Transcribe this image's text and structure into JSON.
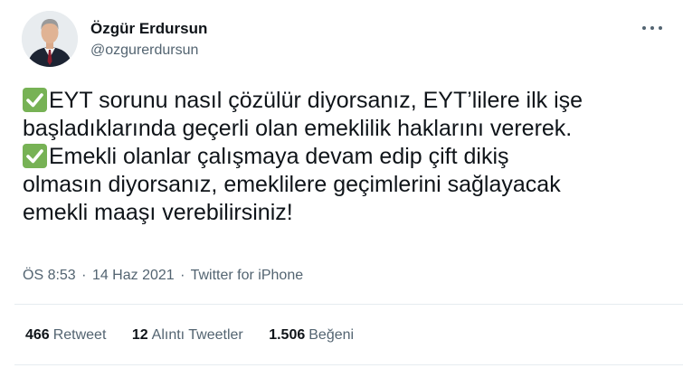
{
  "author": {
    "name": "Özgür Erdursun",
    "handle": "@ozgurerdursun"
  },
  "tweet": {
    "lines": [
      "EYT sorunu nasıl çözülür diyorsanız, EYT’lilere ilk işe",
      "başladıklarında geçerli olan emeklilik haklarını vererek.",
      "Emekli olanlar çalışmaya devam edip çift dikiş",
      "olmasın diyorsanız, emeklilere geçimlerini sağlayacak",
      "emekli maaşı verebilirsiniz!"
    ],
    "check_icon": "white-heavy-check-mark-icon"
  },
  "meta": {
    "time": "ÖS 8:53",
    "date": "14 Haz 2021",
    "source": "Twitter for iPhone",
    "separator": "·"
  },
  "stats": {
    "retweets_count": "466",
    "retweets_label": "Retweet",
    "quotes_count": "12",
    "quotes_label": "Alıntı Tweetler",
    "likes_count": "1.506",
    "likes_label": "Beğeni"
  },
  "colors": {
    "text": "#0f1419",
    "secondary": "#536471",
    "check_green": "#77b255",
    "divider": "#e6ecf0"
  }
}
